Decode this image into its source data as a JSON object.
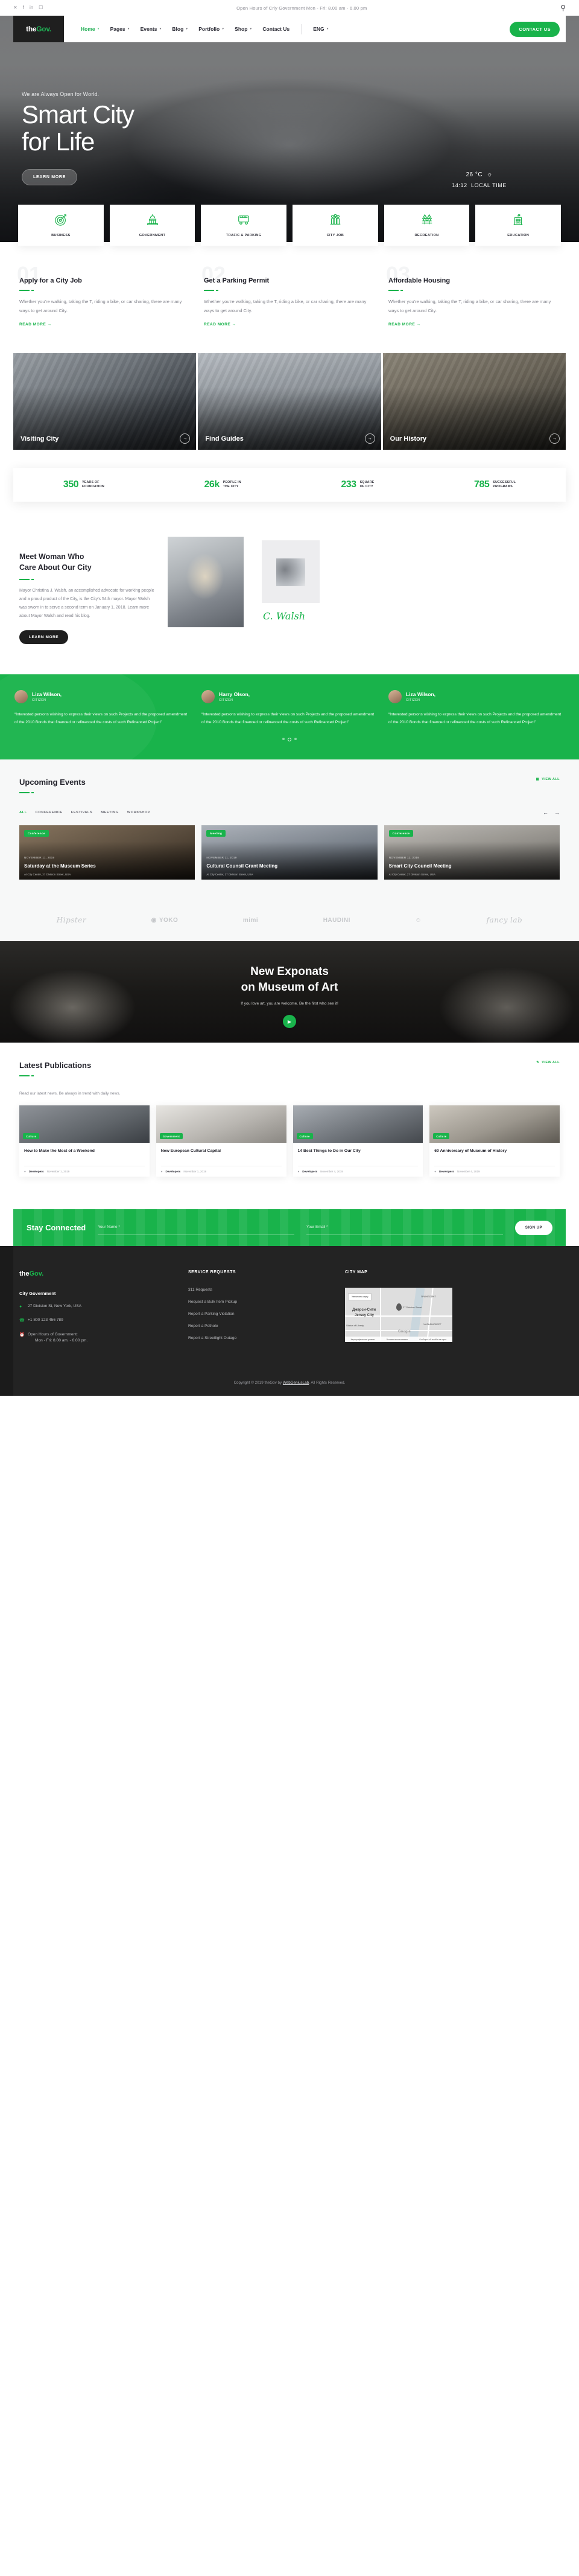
{
  "topbar": {
    "social": [
      "twitter-icon",
      "facebook-icon",
      "linkedin-icon",
      "instagram-icon"
    ],
    "open_hours": "Open Hours of Criy Government Mon - Fri: 8.00 am - 6.00 pm",
    "search_icon": "search-icon"
  },
  "nav": {
    "logo": {
      "pre": "the",
      "accent": "Gov."
    },
    "items": [
      {
        "label": "Home",
        "caret": true,
        "active": true
      },
      {
        "label": "Pages",
        "caret": true,
        "active": false
      },
      {
        "label": "Events",
        "caret": true,
        "active": false
      },
      {
        "label": "Blog",
        "caret": true,
        "active": false
      },
      {
        "label": "Portfolio",
        "caret": true,
        "active": false
      },
      {
        "label": "Shop",
        "caret": true,
        "active": false
      },
      {
        "label": "Contact Us",
        "caret": false,
        "active": false
      }
    ],
    "language": "ENG",
    "contact_button": "CONTACT US"
  },
  "hero": {
    "kicker": "We are Always Open for World.",
    "title_line1": "Smart City",
    "title_line2": "for Life",
    "button": "LEARN MORE",
    "temperature": "26 °C",
    "weather_icon": "sun-icon",
    "local_time": "14:12",
    "local_time_label": "LOCAL TIME"
  },
  "services": [
    {
      "label": "BUSINESS",
      "icon": "target-icon"
    },
    {
      "label": "GOVERNMENT",
      "icon": "capitol-icon"
    },
    {
      "label": "TRAFIC & PARKING",
      "icon": "bus-icon"
    },
    {
      "label": "CITY JOB",
      "icon": "people-icon"
    },
    {
      "label": "RECREATION",
      "icon": "trees-icon"
    },
    {
      "label": "EDUCATION",
      "icon": "school-icon"
    }
  ],
  "three_col": [
    {
      "num": "01",
      "title": "Apply for a City Job",
      "text": "Whether you're walking, taking the T, riding a bike, or car sharing, there are many ways to get around City.",
      "link": "READ MORE →"
    },
    {
      "num": "02",
      "title": "Get a Parking Permit",
      "text": "Whether you're walking, taking the T, riding a bike, or car sharing, there are many ways to get around City.",
      "link": "READ MORE →"
    },
    {
      "num": "03",
      "title": "Affordable Housing",
      "text": "Whether you're walking, taking the T, riding a bike, or car sharing, there are many ways to get around City.",
      "link": "READ MORE →"
    }
  ],
  "photo_cards": [
    {
      "caption": "Visiting City",
      "arrow": "→"
    },
    {
      "caption": "Find Guides",
      "arrow": "→"
    },
    {
      "caption": "Our History",
      "arrow": "→"
    }
  ],
  "stats": [
    {
      "number": "350",
      "label1": "YEARS OF",
      "label2": "FOUNDATION"
    },
    {
      "number": "26k",
      "label1": "PEOPLE IN",
      "label2": "THE CITY"
    },
    {
      "number": "233",
      "label1": "SQUARE",
      "label2": "OF CITY"
    },
    {
      "number": "785",
      "label1": "SUCCESSFUL",
      "label2": "PROGRAMS"
    }
  ],
  "mayor": {
    "title_line1": "Meet Woman Who",
    "title_line2": "Care About Our City",
    "text": "Mayor Christina J. Walsh, an accomplished advocate for working people and a proud product of the City, is the City's 54th mayor. Mayor Walsh was sworn in to serve a second term on January 1, 2018. Learn more about Mayor Walsh and read his blog.",
    "button": "LEARN MORE",
    "signature": "C. Walsh"
  },
  "testimonials": {
    "items": [
      {
        "name": "Liza Wilson,",
        "role": "CITIZEN",
        "quote": "“Interested persons wishing to express their views on such Projects and the proposed amendment of the 2010 Bonds that financed or refinanced the costs of such Refinanced Project”"
      },
      {
        "name": "Harry Olson,",
        "role": "CITIZEN",
        "quote": "“Interested persons wishing to express their views on such Projects and the proposed amendment of the 2010 Bonds that financed or refinanced the costs of such Refinanced Project”"
      },
      {
        "name": "Liza Wilson,",
        "role": "CITIZEN",
        "quote": "“Interested persons wishing to express their views on such Projects and the proposed amendment of the 2010 Bonds that financed or refinanced the costs of such Refinanced Project”"
      }
    ],
    "dots": 3,
    "active_dot": 1
  },
  "events": {
    "title": "Upcoming Events",
    "view_all": "VIEW ALL",
    "view_all_icon": "calendar-icon",
    "filters": [
      "ALL",
      "CONFERENCE",
      "FESTIVALS",
      "MEETING",
      "WORKSHOP"
    ],
    "active_filter": "ALL",
    "prev_icon": "arrow-left-icon",
    "next_icon": "arrow-right-icon",
    "cards": [
      {
        "chip": "Conference",
        "date": "NOVEMBER 11, 2019",
        "title": "Saturday at the Museum Series",
        "location": "At City Center, 27 Division Street, USA"
      },
      {
        "chip": "Meeting",
        "date": "NOVEMBER 11, 2019",
        "title": "Cultural Counsil Grant Meeting",
        "location": "At City Center, 27 Division Street, USA"
      },
      {
        "chip": "Conference",
        "date": "NOVEMBER 11, 2019",
        "title": "Smart City Council Meeting",
        "location": "At City Center, 27 Division Street, USA"
      }
    ]
  },
  "brands": [
    "Hipster",
    "YOKO",
    "mimi",
    "HAUDINI",
    "fancy",
    "lab"
  ],
  "exponats": {
    "title_line1": "New Exponats",
    "title_line2": "on Museum of Art",
    "subtitle": "If you love art, you are welcome. Be the first who see it!",
    "play_icon": "play-icon"
  },
  "publications": {
    "title": "Latest Publications",
    "view_all": "VIEW ALL",
    "view_all_icon": "pencil-icon",
    "subtitle": "Read our latest news. Be always in trend with daily news.",
    "cards": [
      {
        "chip": "Culture",
        "title": "How to Make the Most of a Weekend",
        "author": "Developers",
        "date": "November 1, 2019"
      },
      {
        "chip": "Government",
        "title": "New European Cultural Capital",
        "author": "Developers",
        "date": "November 1, 2019"
      },
      {
        "chip": "Culture",
        "title": "14 Best Things to Do in Our City",
        "author": "Developers",
        "date": "November 4, 2019"
      },
      {
        "chip": "Culture",
        "title": "60 Anniversary of Museum of History",
        "author": "Developers",
        "date": "November 4, 2019"
      }
    ]
  },
  "newsletter": {
    "title": "Stay Connected",
    "name_placeholder": "Your Name *",
    "email_placeholder": "Your Email *",
    "button": "SIGN UP"
  },
  "footer": {
    "logo": {
      "pre": "the",
      "accent": "Gov."
    },
    "heading": "City Government",
    "address": "27 Division St, New York, USA",
    "phone": "+1 800 123 456 789",
    "hours_line1": "Open Hours of Government:",
    "hours_line2": "Mon - Fri: 8.00 am. - 6.00 pm.",
    "service_title": "SERVICE REQUESTS",
    "service_links": [
      "311 Requests",
      "Request a Bulk Item Pickup",
      "Report a Parking Violation",
      "Report a Pothole",
      "Report a Streetlight Outage"
    ],
    "map_title": "CITY MAP",
    "map": {
      "button": "Увеличить карту",
      "city_ru": "Джерси-Сити",
      "city_en": "Jersey City",
      "street": "27 Division Street",
      "label_greenpoint": "ГРИНПОЙНТ",
      "label_williamsburg": "УИЛЬЯМСБЕРГ",
      "label_statue": "Statue of Liberty",
      "watermark": "Google",
      "bar": [
        "Картографические данные",
        "Условия использования",
        "Сообщить об ошибке на карте"
      ]
    },
    "copyright_pre": "Copyright © 2019 theGov by ",
    "copyright_link": "WebGeniusLab",
    "copyright_post": ". All Rights Reserved."
  },
  "colors": {
    "accent": "#19b34b",
    "dark": "#1f1f1f",
    "text": "#2b2b35"
  }
}
